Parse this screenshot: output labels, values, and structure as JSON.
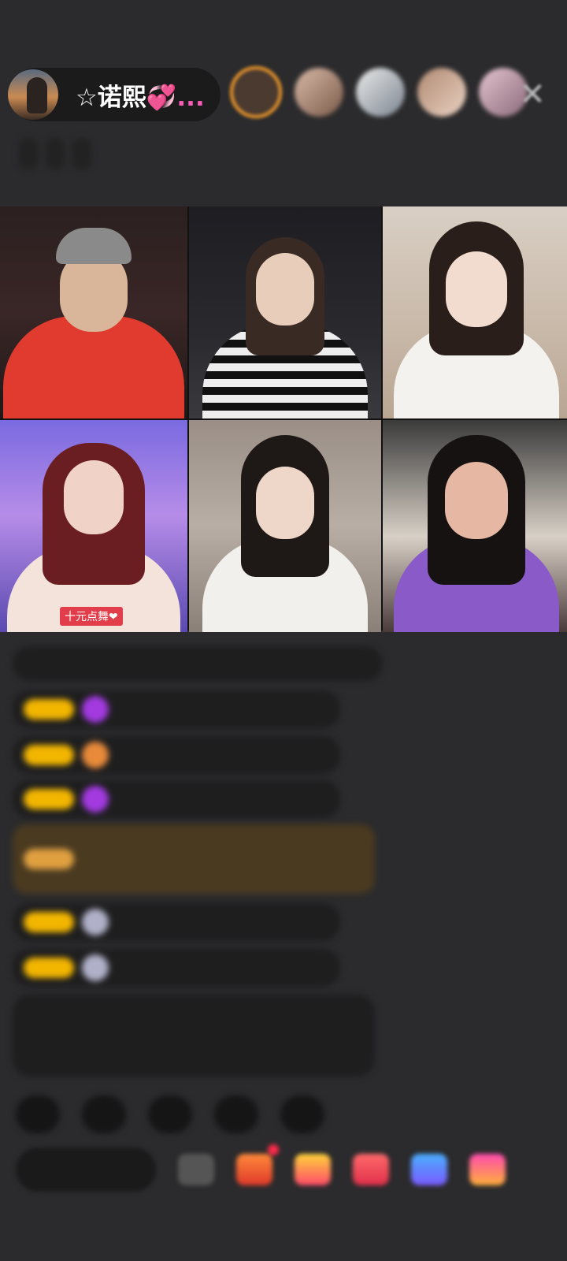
{
  "header": {
    "host_name": "☆诺熙",
    "host_name_suffix": "💞...",
    "close_icon": "close-icon"
  },
  "colors": {
    "background": "#2b2b2d",
    "pill": "#1b1b1c",
    "level_badge": "#f2b500",
    "first_viewer_ring": "#f29a2a"
  },
  "video_grid": {
    "tiles": [
      {
        "label": ""
      },
      {
        "label": ""
      },
      {
        "label": ""
      },
      {
        "label": "十元点舞❤"
      },
      {
        "label": ""
      },
      {
        "label": ""
      }
    ]
  },
  "bottom_bar": {
    "icons": [
      "emoji-icon",
      "gift-box-icon",
      "red-packet-icon",
      "heart-gift-icon",
      "game-icon",
      "gift-icon"
    ]
  }
}
